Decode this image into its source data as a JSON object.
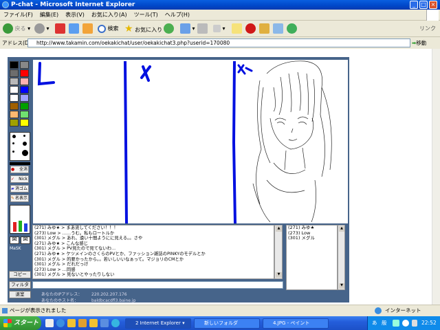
{
  "window": {
    "title": "P-chat - Microsoft Internet Explorer"
  },
  "menu": [
    "ファイル(F)",
    "編集(E)",
    "表示(V)",
    "お気に入り(A)",
    "ツール(T)",
    "ヘルプ(H)"
  ],
  "toolbar": {
    "back": "戻る",
    "search": "検索",
    "favorites": "お気に入り",
    "links": "リンク"
  },
  "address": {
    "label": "アドレス(D)",
    "url": "http://www.takamin.com/oekakichat/user/oekakichat3.php?userid=170080",
    "go": "移動"
  },
  "applet": {
    "palette": [
      "#000000",
      "#888888",
      "#6d6d6d",
      "#ff0000",
      "#b8b8b8",
      "#ffb0b0",
      "#ffffff",
      "#0000ff",
      "#ffffff",
      "#a0a0ff",
      "#a06000",
      "#00a000",
      "#ffb870",
      "#70e070",
      "#a0a000",
      "#ffff00"
    ],
    "tools": {
      "all_clear": "全消",
      "nick": "Nick",
      "eraser": "消ゴム",
      "display": "名表示"
    },
    "canvas_text": [
      "L",
      "メ",
      "メモ"
    ],
    "chat_lines": [
      "(271) みゆ★ > まあ流してください！！！",
      "(273) Low > ……うむ。私もロートルか",
      "(301) メグル > あれ、遠い十間ようにに見える。。さや",
      "(271) みゆ★ > こんな感じ",
      "(301) メグル > PV見たので見てないわ…",
      "(271) みゆ★ > ケツメインのさくらのPVとか、ファッション雑誌のPINKYのモデルとか",
      "(301) メグル > 的要かったから。。若いしいいなぁって。マジョリのCMとか",
      "(301) メグル > だれだっけ",
      "(273) Low > …同感",
      "(301) メグル > 見ないとやったりしない"
    ],
    "users": [
      "(271) みゆ★",
      "(273) Low",
      "(301) メグル"
    ],
    "side_buttons": {
      "copy": "コピー",
      "filter": "フィルタ",
      "leave": "退室"
    },
    "info": {
      "ip_label": "あなたのIPアドレス：",
      "ip": "220.202.207.176",
      "host_label": "あなたのホスト名：",
      "host": "baldbcacdfl3.baine.jp"
    },
    "mascot_label": "MaSK"
  },
  "status": {
    "text": "ページが表示されました",
    "zone": "インターネット"
  },
  "taskbar": {
    "start": "スタート",
    "tasks": [
      "2 Internet Explorer",
      "新しいフォルダ",
      "4.JPG - ペイント"
    ],
    "clock": "22:52"
  },
  "colors": {
    "titlebar": "#0047c8",
    "applet_bg": "#46648a",
    "taskbar": "#245edb",
    "start": "#2f9030",
    "pen_blue": "#0010e0"
  }
}
